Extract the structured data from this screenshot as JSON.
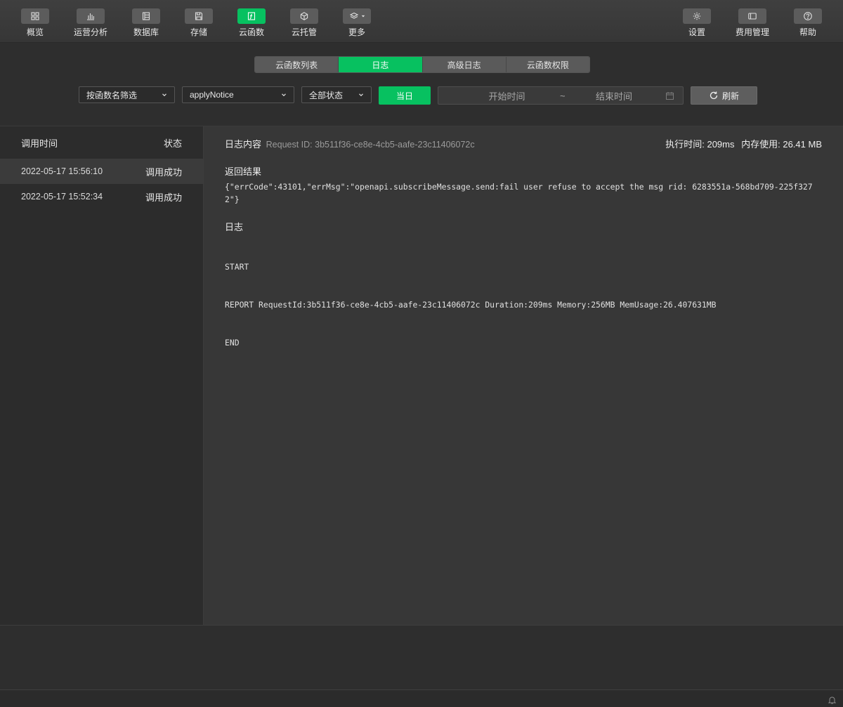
{
  "toolbar": {
    "left_items": [
      {
        "label": "概览",
        "icon": "grid-icon"
      },
      {
        "label": "运营分析",
        "icon": "bar-chart-icon"
      },
      {
        "label": "数据库",
        "icon": "database-icon"
      },
      {
        "label": "存储",
        "icon": "floppy-icon"
      },
      {
        "label": "云函数",
        "icon": "function-icon",
        "active": true
      },
      {
        "label": "云托管",
        "icon": "cube-icon"
      },
      {
        "label": "更多",
        "icon": "layers-icon"
      }
    ],
    "right_items": [
      {
        "label": "设置",
        "icon": "gear-icon"
      },
      {
        "label": "费用管理",
        "icon": "billing-icon"
      },
      {
        "label": "帮助",
        "icon": "help-icon"
      }
    ]
  },
  "tabs": [
    "云函数列表",
    "日志",
    "高级日志",
    "云函数权限"
  ],
  "active_tab": "日志",
  "filters": {
    "filter_type": "按函数名筛选",
    "function_name": "applyNotice",
    "status": "全部状态",
    "today": "当日",
    "start_placeholder": "开始时间",
    "separator": "~",
    "end_placeholder": "结束时间",
    "refresh": "刷新"
  },
  "log_list": {
    "header_time": "调用时间",
    "header_status": "状态",
    "rows": [
      {
        "time": "2022-05-17 15:56:10",
        "status": "调用成功",
        "selected": true
      },
      {
        "time": "2022-05-17 15:52:34",
        "status": "调用成功",
        "selected": false
      }
    ]
  },
  "detail": {
    "title": "日志内容",
    "request_id": "Request ID: 3b511f36-ce8e-4cb5-aafe-23c11406072c",
    "exec_time": "执行时间: 209ms",
    "memory": "内存使用: 26.41 MB",
    "result_title": "返回结果",
    "result": "{\"errCode\":43101,\"errMsg\":\"openapi.subscribeMessage.send:fail user refuse to accept the msg rid: 6283551a-568bd709-225f3272\"}",
    "log_title": "日志",
    "log_lines": [
      "START",
      "REPORT RequestId:3b511f36-ce8e-4cb5-aafe-23c11406072c Duration:209ms Memory:256MB MemUsage:26.407631MB",
      "END"
    ]
  },
  "colors": {
    "accent": "#07c160",
    "background": "#2e2e2e",
    "panel": "#373737"
  }
}
